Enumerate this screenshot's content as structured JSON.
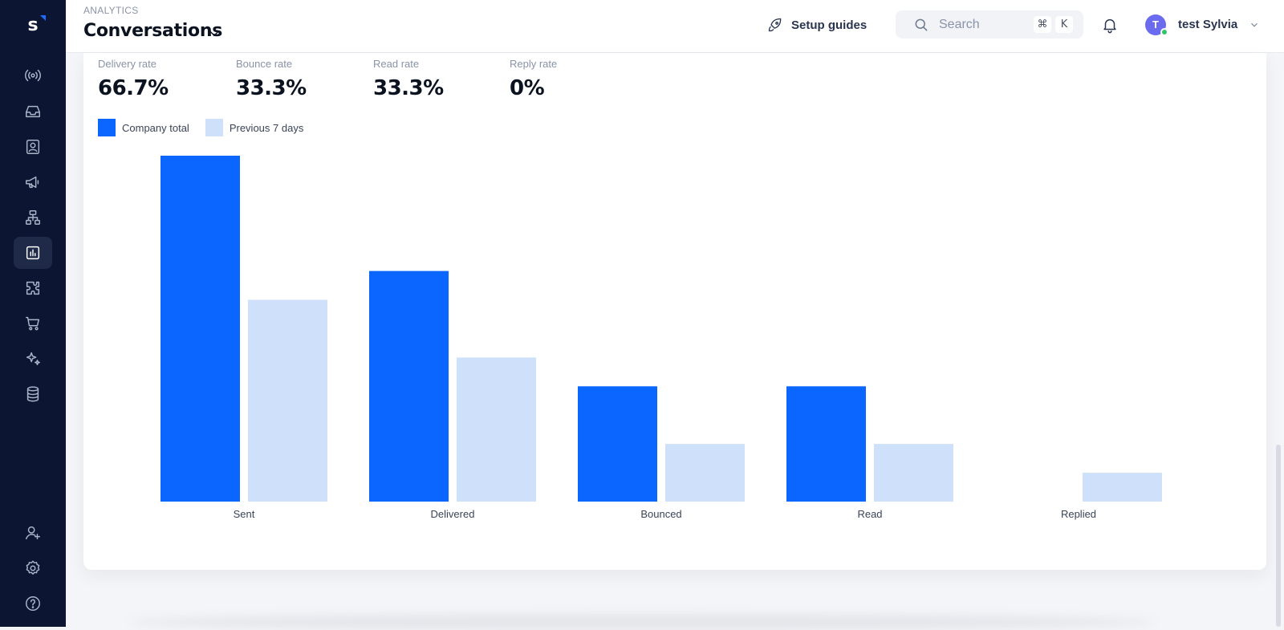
{
  "header": {
    "breadcrumb": "ANALYTICS",
    "title": "Conversations",
    "setup_label": "Setup guides",
    "search_placeholder": "Search",
    "shortcut_cmd": "⌘",
    "shortcut_key": "K",
    "user_initial": "T",
    "user_name": "test Sylvia"
  },
  "sidebar": {
    "logo": "s",
    "items": [
      {
        "icon": "broadcast-icon"
      },
      {
        "icon": "inbox-icon"
      },
      {
        "icon": "contacts-icon"
      },
      {
        "icon": "megaphone-icon"
      },
      {
        "icon": "flows-icon"
      },
      {
        "icon": "analytics-icon",
        "active": true
      },
      {
        "icon": "integrations-icon"
      },
      {
        "icon": "cart-icon"
      },
      {
        "icon": "ai-sparkle-icon"
      },
      {
        "icon": "database-icon"
      },
      {
        "icon": "add-user-icon"
      },
      {
        "icon": "settings-icon"
      },
      {
        "icon": "help-icon"
      }
    ]
  },
  "metrics": [
    {
      "label": "Delivery rate",
      "value": "66.7%"
    },
    {
      "label": "Bounce rate",
      "value": "33.3%"
    },
    {
      "label": "Read rate",
      "value": "33.3%"
    },
    {
      "label": "Reply rate",
      "value": "0%"
    }
  ],
  "chart_data": {
    "type": "bar",
    "categories": [
      "Sent",
      "Delivered",
      "Bounced",
      "Read",
      "Replied"
    ],
    "series": [
      {
        "name": "Company total",
        "color": "#0a66ff",
        "values": [
          3,
          2,
          1,
          1,
          0
        ]
      },
      {
        "name": "Previous 7 days",
        "color": "#cfe0fb",
        "values": [
          1.75,
          1.25,
          0.5,
          0.5,
          0.25
        ]
      }
    ],
    "ylim": [
      0,
      3
    ],
    "legend": "top-left",
    "grid": false
  }
}
